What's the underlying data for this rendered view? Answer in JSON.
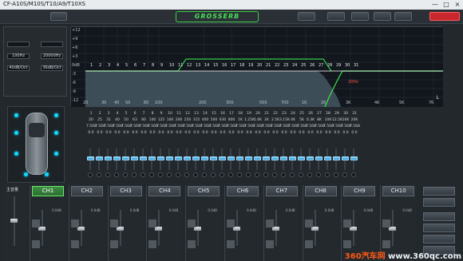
{
  "title": "CF-A10S/M10S/T10/A9/T10XS",
  "window_controls": {
    "min": "—",
    "max": "□",
    "close": "×"
  },
  "toolbar": {
    "input_label": "",
    "mode_value": "",
    "logo": "GROSSERB",
    "btn_a": "",
    "btn_b": "",
    "btn_c": "",
    "btn_d": "",
    "btn_e": "",
    "btn_f": "",
    "state_button": ""
  },
  "left_panel": {
    "section": "",
    "left_col": "",
    "right_col": "",
    "filter_a": "",
    "filter_b": "",
    "hz_a": "100Hz",
    "hz_b": "20000Hz",
    "db_a": "40dB/Oct",
    "db_b": "36dB/Oct",
    "preset_a": "",
    "preset_b": "",
    "preset_c": ""
  },
  "chart_data": {
    "type": "line",
    "x_ticks": [
      "20",
      "30",
      "40",
      "50",
      "80",
      "100",
      "200",
      "300",
      "500",
      "700",
      "1K",
      "2K",
      "3K",
      "4K",
      "5K",
      "7K",
      "10K",
      "20K"
    ],
    "y_ticks": [
      "+12",
      "+9",
      "+6",
      "+3",
      "0dB",
      "-3",
      "-6",
      "-9",
      "-12"
    ],
    "band_numbers": [
      "1",
      "2",
      "3",
      "4",
      "5",
      "6",
      "7",
      "8",
      "9",
      "10",
      "11",
      "12",
      "13",
      "14",
      "15",
      "16",
      "17",
      "18",
      "19",
      "20",
      "21",
      "22",
      "23",
      "24",
      "25",
      "26",
      "27",
      "28",
      "29",
      "30",
      "31"
    ],
    "annotation": "20Hz",
    "corner_label": "L"
  },
  "band_table": {
    "row_labels": [
      "",
      "",
      "",
      ""
    ],
    "gains": [
      "0.0",
      "0.0",
      "0.0",
      "0.0",
      "0.0",
      "0.0",
      "0.0",
      "0.0",
      "0.0",
      "0.0",
      "0.0",
      "0.0",
      "0.0",
      "0.0",
      "0.0",
      "0.0",
      "0.0",
      "0.0",
      "0.0",
      "0.0",
      "0.0",
      "0.0",
      "0.0",
      "0.0",
      "0.0",
      "0.0",
      "0.0",
      "0.0",
      "0.0",
      "0.0",
      "0.0"
    ],
    "freqs": [
      "20",
      "25",
      "31",
      "40",
      "50",
      "63",
      "80",
      "100",
      "125",
      "160",
      "200",
      "250",
      "315",
      "400",
      "500",
      "630",
      "800",
      "1K",
      "1.25K",
      "1.6K",
      "2K",
      "2.5K",
      "3.15K",
      "4K",
      "5K",
      "6.3K",
      "8K",
      "10K",
      "12.5K",
      "16K",
      "20K"
    ],
    "qs": [
      "7.568",
      "7.568",
      "7.568",
      "7.568",
      "7.568",
      "7.568",
      "7.568",
      "7.568",
      "7.568",
      "7.568",
      "7.568",
      "7.568",
      "7.568",
      "7.568",
      "7.568",
      "7.568",
      "7.568",
      "7.568",
      "7.568",
      "7.568",
      "7.568",
      "7.568",
      "7.568",
      "7.568",
      "7.568",
      "7.568",
      "7.568",
      "7.568",
      "7.568",
      "7.568",
      "7.568"
    ],
    "mute_label": ""
  },
  "channels": [
    {
      "name": "CH1",
      "preset": "",
      "value": "0.0dB"
    },
    {
      "name": "CH2",
      "preset": "",
      "value": "0.0dB"
    },
    {
      "name": "CH3",
      "preset": "",
      "value": "0.0dB"
    },
    {
      "name": "CH4",
      "preset": "",
      "value": "0.0dB"
    },
    {
      "name": "CH5",
      "preset": "",
      "value": "0.0dB"
    },
    {
      "name": "CH6",
      "preset": "",
      "value": "0.0dB"
    },
    {
      "name": "CH7",
      "preset": "",
      "value": "0.0dB"
    },
    {
      "name": "CH8",
      "preset": "",
      "value": "0.0dB"
    },
    {
      "name": "CH9",
      "preset": "",
      "value": "0.0dB"
    },
    {
      "name": "CH10",
      "preset": "",
      "value": "0.0dB"
    }
  ],
  "right_buttons": [
    "",
    "",
    "",
    "",
    "",
    ""
  ],
  "watermark": {
    "brand": "360汽车网",
    "site": "www.360qc.com"
  }
}
